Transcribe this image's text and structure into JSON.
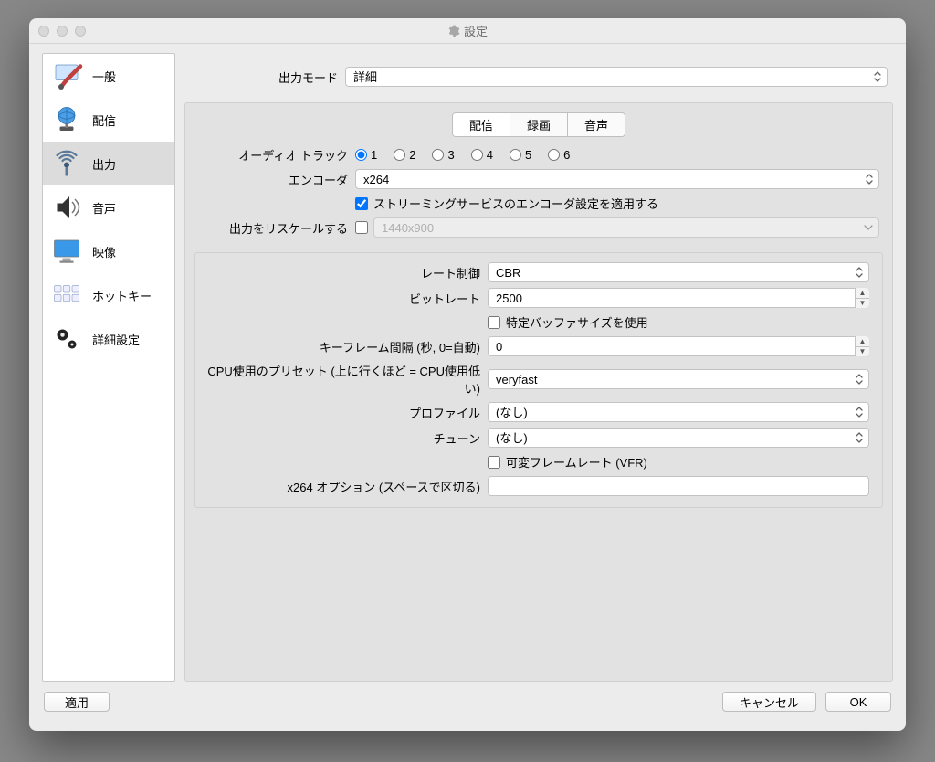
{
  "window_title": "設定",
  "sidebar": {
    "items": [
      {
        "label": "一般"
      },
      {
        "label": "配信"
      },
      {
        "label": "出力"
      },
      {
        "label": "音声"
      },
      {
        "label": "映像"
      },
      {
        "label": "ホットキー"
      },
      {
        "label": "詳細設定"
      }
    ]
  },
  "top": {
    "output_mode_label": "出力モード",
    "output_mode_value": "詳細"
  },
  "subtabs": [
    "配信",
    "録画",
    "音声"
  ],
  "upper": {
    "audio_track_label": "オーディオ トラック",
    "audio_tracks": [
      "1",
      "2",
      "3",
      "4",
      "5",
      "6"
    ],
    "audio_track_selected": "1",
    "encoder_label": "エンコーダ",
    "encoder_value": "x264",
    "apply_service_settings_label": "ストリーミングサービスのエンコーダ設定を適用する",
    "rescale_label": "出力をリスケールする",
    "rescale_value": "1440x900"
  },
  "lower": {
    "rate_control_label": "レート制御",
    "rate_control_value": "CBR",
    "bitrate_label": "ビットレート",
    "bitrate_value": "2500",
    "custom_buffer_label": "特定バッファサイズを使用",
    "keyint_label": "キーフレーム間隔 (秒, 0=自動)",
    "keyint_value": "0",
    "preset_label": "CPU使用のプリセット (上に行くほど = CPU使用低い)",
    "preset_value": "veryfast",
    "profile_label": "プロファイル",
    "profile_value": "(なし)",
    "tune_label": "チューン",
    "tune_value": "(なし)",
    "vfr_label": "可変フレームレート (VFR)",
    "x264opts_label": "x264 オプション (スペースで区切る)",
    "x264opts_value": ""
  },
  "footer": {
    "apply": "適用",
    "cancel": "キャンセル",
    "ok": "OK"
  }
}
